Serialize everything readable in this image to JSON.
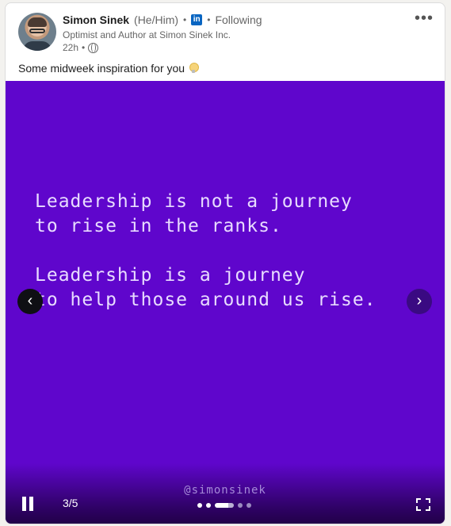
{
  "post": {
    "author": {
      "name": "Simon Sinek",
      "pronouns": "(He/Him)",
      "badge": "in",
      "follow_status": "Following",
      "headline": "Optimist and Author at Simon Sinek Inc.",
      "time": "22h",
      "visibility_icon": "globe-icon"
    },
    "more_icon": "•••",
    "caption": "Some midweek inspiration for you",
    "caption_icon": "lightbulb-icon"
  },
  "slide": {
    "background": "#5f06cc",
    "lines": [
      "Leadership is not a journey",
      "to rise in the ranks.",
      "Leadership is a journey",
      "to help those around us rise."
    ],
    "handle": "@simonsinek",
    "prev_label": "‹",
    "next_label": "›"
  },
  "carousel": {
    "counter": "3/5",
    "current": 3,
    "total": 5,
    "progress_fraction": 0.7
  },
  "colors": {
    "linkedin_blue": "#0a66c2",
    "slide_text": "#e8dcff"
  }
}
